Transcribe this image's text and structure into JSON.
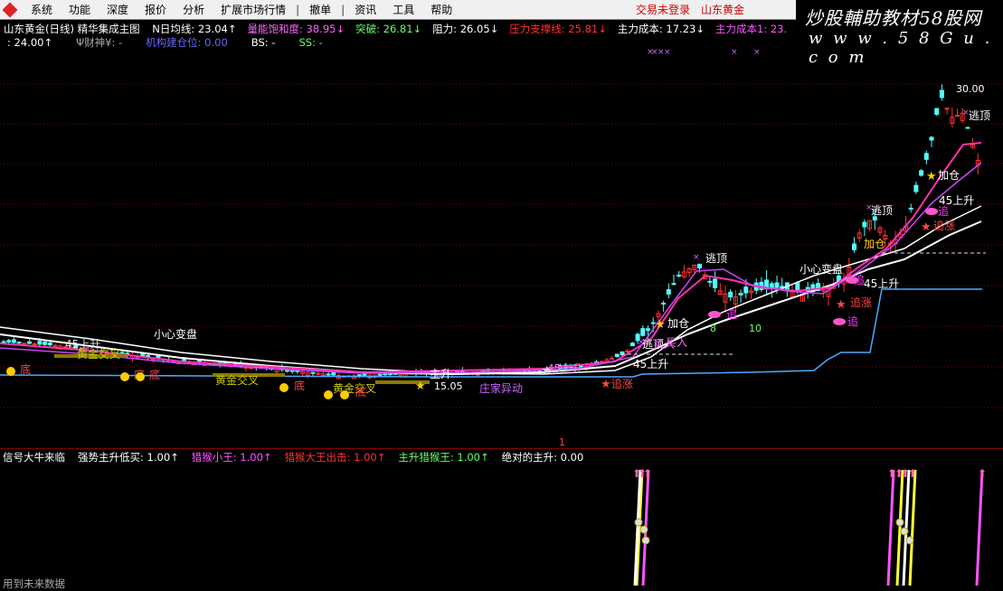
{
  "menu": {
    "items": [
      "系统",
      "功能",
      "深度",
      "报价",
      "分析",
      "扩展市场行情",
      "撤单",
      "资讯",
      "工具",
      "帮助"
    ],
    "login_status": "交易未登录",
    "stock_name": "山东黄金"
  },
  "watermark": {
    "line1": "炒股輔助教材58股网",
    "line2": "w w w . 5 8 G u . c o m"
  },
  "indicator_line1": {
    "title": "山东黄金(日线) 精华集成主图",
    "items": [
      {
        "label": "N日均线: 23.04↑",
        "color": "#ffffff"
      },
      {
        "label": "量能饱和度: 38.95↓",
        "color": "#ff66ff"
      },
      {
        "label": "突破: 26.81↓",
        "color": "#66ff66"
      },
      {
        "label": "阻力: 26.05↓",
        "color": "#ffffff"
      },
      {
        "label": "压力支撑线: 25.81↓",
        "color": "#ff3333"
      },
      {
        "label": "主力成本: 17.23↓",
        "color": "#ffffff"
      },
      {
        "label": "主力成本1: 23.",
        "color": "#ff55ff"
      }
    ]
  },
  "indicator_line2": {
    "items": [
      {
        "label": ": 24.00↑",
        "color": "#ffffff"
      },
      {
        "label": "Ψ财神¥: -",
        "color": "#aaaaaa"
      },
      {
        "label": "机构建仓位: 0.00",
        "color": "#6666ff"
      },
      {
        "label": "BS: -",
        "color": "#ffffff"
      },
      {
        "label": "SS: -",
        "color": "#66ff66"
      }
    ]
  },
  "sub_indicator": {
    "items": [
      {
        "label": "信号大牛来临",
        "color": "#ffffff"
      },
      {
        "label": "强势主升低买: 1.00↑",
        "color": "#ffffff"
      },
      {
        "label": "猎猴小王: 1.00↑",
        "color": "#ff55ff"
      },
      {
        "label": "猎猴大王出击: 1.00↑",
        "color": "#ff3333"
      },
      {
        "label": "主升猎猴王: 1.00↑",
        "color": "#66ff66"
      },
      {
        "label": "绝对的主升: 0.00",
        "color": "#ffffff"
      }
    ],
    "footer": "用到未来数据"
  },
  "chart_data": {
    "type": "candlestick",
    "max_price_label": "30.00",
    "min_price_label": "15.05",
    "annotations": [
      "小心变盘",
      "小心变盘",
      "庄家异动",
      "逃顶",
      "逃顶",
      "逃顶",
      "逃顶",
      "加仓",
      "加仓",
      "加仓",
      "追",
      "追",
      "追",
      "追",
      "追涨",
      "追涨",
      "追涨",
      "45上升",
      "45上升",
      "45上升",
      "45上升",
      "45上升",
      "买入",
      "买入",
      "主升",
      "黄金交叉",
      "黄金交叉",
      "黄金交叉",
      "底",
      "底",
      "底",
      "底",
      "底"
    ],
    "markers": [
      "8",
      "10",
      "1"
    ],
    "colors": {
      "up": "#ff3232",
      "down": "#54fcfc",
      "ma_white": "#ffffff",
      "ma_magenta": "#ff33aa",
      "ma_purple": "#cc44ff",
      "cost_line": "#4fa9ff",
      "gold": "#ffcc00"
    }
  }
}
